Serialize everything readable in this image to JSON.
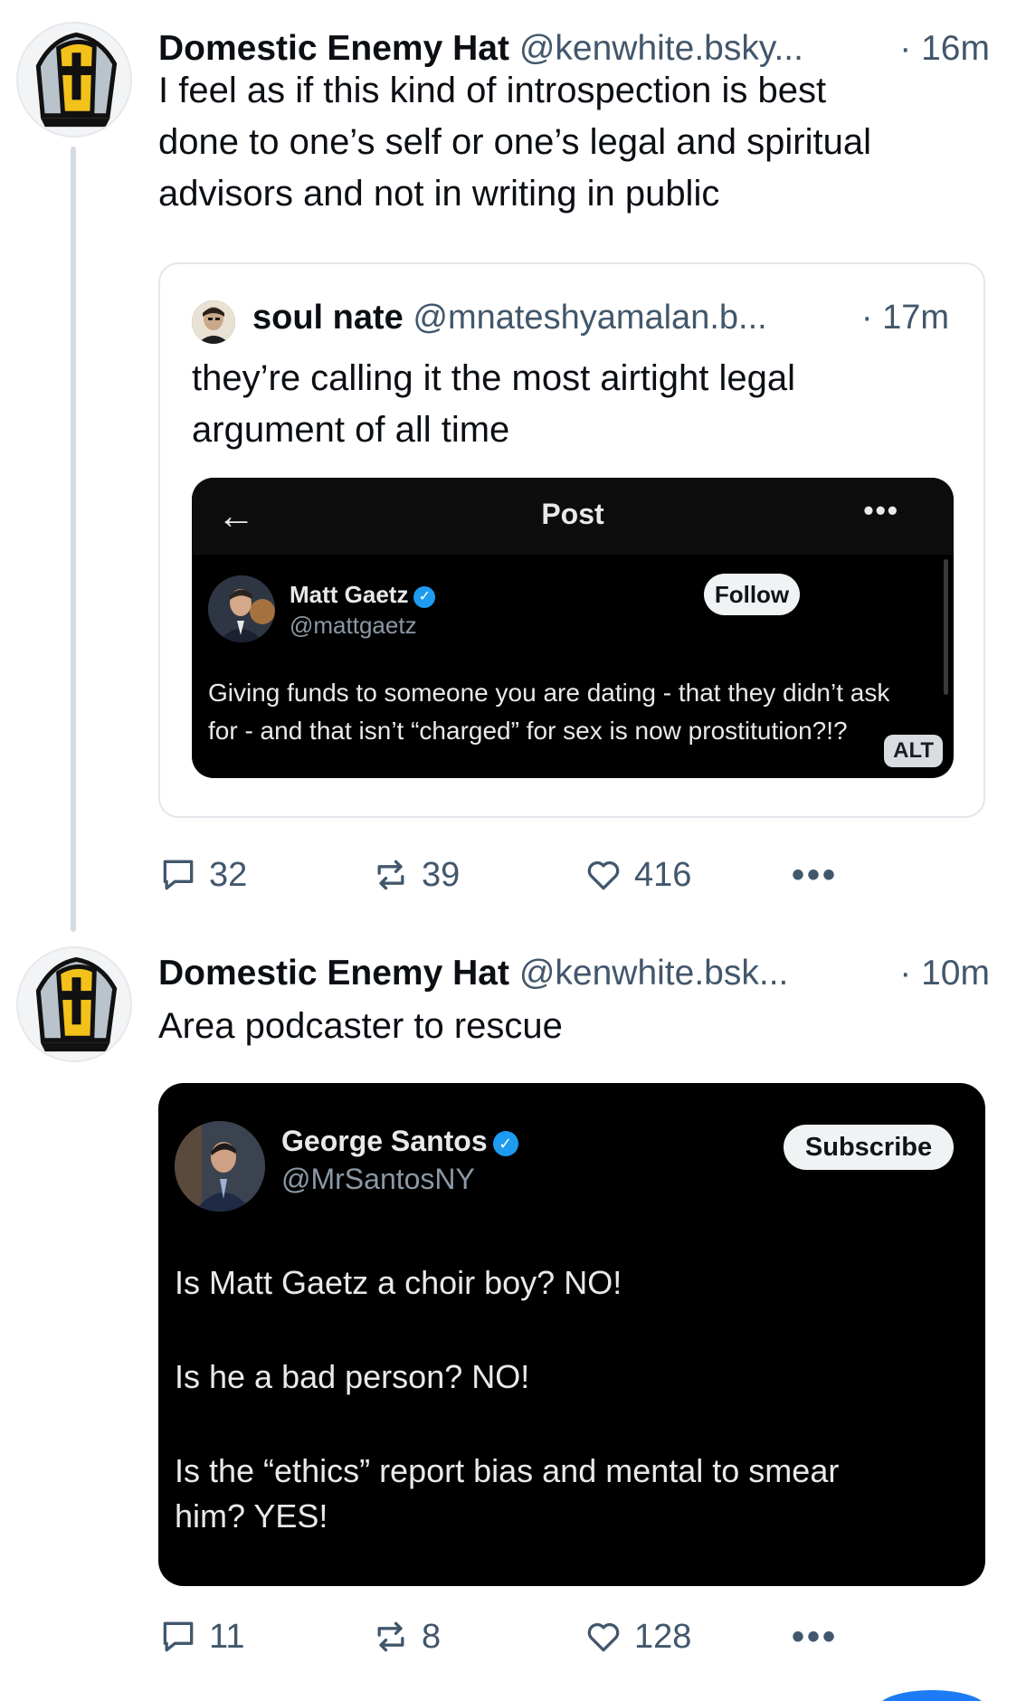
{
  "post1": {
    "author_name": "Domestic Enemy Hat",
    "author_handle": "@kenwhite.bsky...",
    "time": "· 16m",
    "text_lines": [
      "I feel as if this kind of introspection is best",
      "done to one’s self or one’s legal and spiritual",
      "advisors and not in writing in public"
    ],
    "quote": {
      "author_name": "soul nate",
      "author_handle": "@mnateshyamalan.b...",
      "time": "· 17m",
      "text_lines": [
        "they’re calling it the most airtight legal",
        "argument of all time"
      ],
      "embed": {
        "back_arrow": "←",
        "title": "Post",
        "more_dots": "•••",
        "account_name": "Matt Gaetz",
        "account_handle": "@mattgaetz",
        "follow_label": "Follow",
        "text_lines": [
          "Giving funds to someone you are dating - that they didn’t ask",
          "for - and that isn’t “charged” for sex is now prostitution?!?"
        ],
        "alt_badge": "ALT"
      }
    },
    "actions": {
      "replies": "32",
      "reposts": "39",
      "likes": "416",
      "more": "•••"
    }
  },
  "post2": {
    "author_name": "Domestic Enemy Hat",
    "author_handle": "@kenwhite.bsk...",
    "time": "· 10m",
    "text": "Area podcaster to rescue",
    "embed": {
      "account_name": "George Santos",
      "account_handle": "@MrSantosNY",
      "subscribe_label": "Subscribe",
      "lines": [
        "Is Matt Gaetz a choir boy? NO!",
        "Is he a bad person? NO!",
        "Is the “ethics” report bias and mental to smear",
        "him? YES!"
      ]
    },
    "actions": {
      "replies": "11",
      "reposts": "8",
      "likes": "128",
      "more": "•••"
    }
  },
  "icons": {
    "reply": "reply-icon",
    "repost": "repost-icon",
    "like": "heart-icon",
    "more": "more-icon",
    "verified": "verified-badge-icon"
  },
  "colors": {
    "muted": "#42576c",
    "verified_blue": "#1d9bf0",
    "hat_yellow": "#f2c21b"
  }
}
